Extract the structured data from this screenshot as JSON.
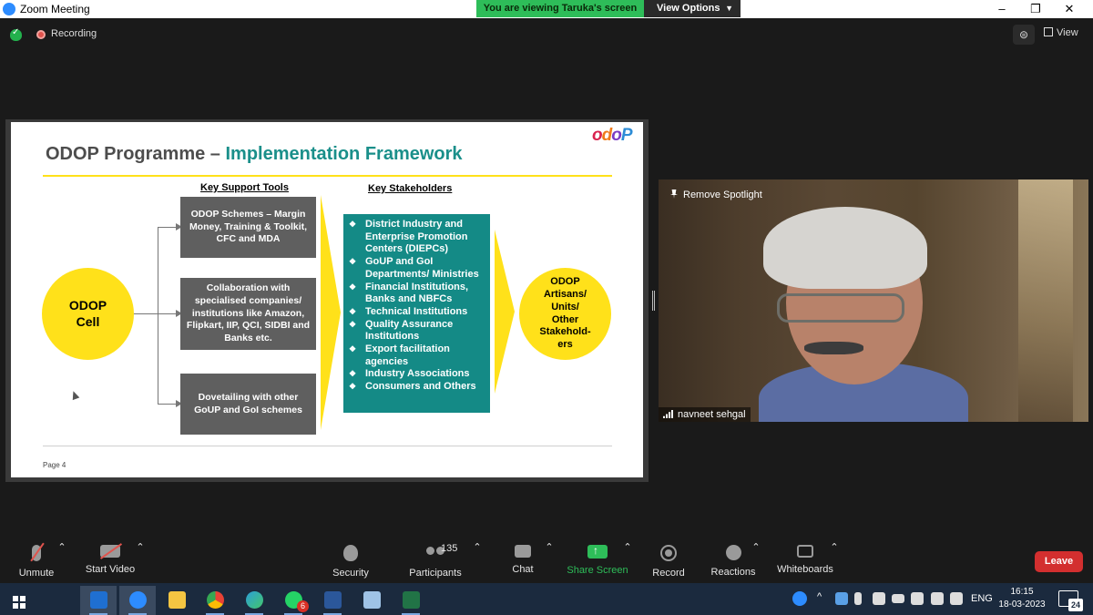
{
  "window": {
    "title": "Zoom Meeting",
    "minimize": "–",
    "restore": "❐",
    "close": "✕"
  },
  "banner": {
    "message": "You are viewing Taruka's screen",
    "options_label": "View Options"
  },
  "status": {
    "recording_label": "Recording",
    "view_label": "View"
  },
  "slide": {
    "title_main": "ODOP Programme – ",
    "title_accent": "Implementation Framework",
    "logo": [
      "o",
      "d",
      "o",
      "P"
    ],
    "support_tools_header": "Key Support Tools",
    "stakeholders_header": "Key Stakeholders",
    "cell_label": "ODOP Cell",
    "tools": [
      "ODOP Schemes – Margin Money, Training & Toolkit, CFC and MDA",
      "Collaboration with specialised companies/ institutions like Amazon, Flipkart, IIP, QCI, SIDBI and Banks etc.",
      "Dovetailing with other GoUP and GoI schemes"
    ],
    "stakeholders": [
      "District Industry and Enterprise Promotion Centers (DIEPCs)",
      "GoUP and GoI Departments/ Ministries",
      "Financial Institutions, Banks and NBFCs",
      "Technical Institutions",
      "Quality Assurance Institutions",
      "Export facilitation agencies",
      "Industry Associations",
      "Consumers and Others"
    ],
    "target_label": "ODOP Artisans/ Units/ Other Stakehold-ers",
    "page_label": "Page 4",
    "colors": {
      "accent": "#1a8f8a",
      "yellow": "#ffe11a",
      "box": "#5f5f5f",
      "teal": "#148a86"
    }
  },
  "video": {
    "spotlight_label": "Remove Spotlight",
    "participant_name": "navneet sehgal"
  },
  "toolbar": {
    "unmute": "Unmute",
    "start_video": "Start Video",
    "security": "Security",
    "participants": "Participants",
    "participants_count": "135",
    "chat": "Chat",
    "share_screen": "Share Screen",
    "record": "Record",
    "reactions": "Reactions",
    "whiteboards": "Whiteboards",
    "leave": "Leave",
    "caret": "⌃"
  },
  "taskbar": {
    "apps": [
      {
        "name": "outlook",
        "color": "#1f6fd1"
      },
      {
        "name": "zoom",
        "color": "#2d8cff"
      },
      {
        "name": "file-explorer",
        "color": "#f4c542"
      },
      {
        "name": "chrome",
        "color": "#e94235"
      },
      {
        "name": "edge",
        "color": "#2c9fd8"
      },
      {
        "name": "whatsapp",
        "color": "#25d366"
      },
      {
        "name": "word",
        "color": "#2b579a"
      },
      {
        "name": "notepad",
        "color": "#9fc3e6"
      },
      {
        "name": "excel",
        "color": "#217346"
      }
    ],
    "whatsapp_badge": "6",
    "lang": "ENG",
    "time": "16:15",
    "date": "18-03-2023",
    "notifications": "24",
    "tray_up": "^"
  }
}
